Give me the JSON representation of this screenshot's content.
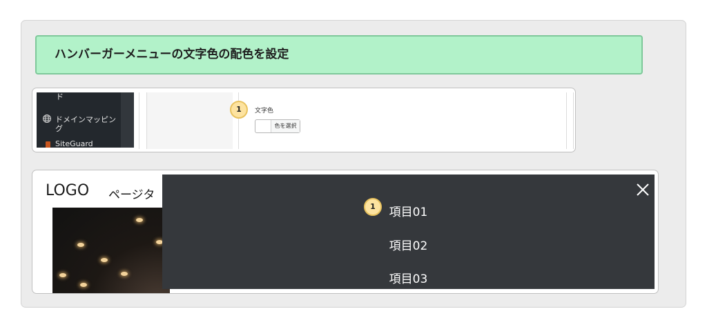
{
  "banner": {
    "title": "ハンバーガーメニューの文字色の配色を設定"
  },
  "settings": {
    "sidebar": {
      "top_fragment": "ド",
      "item1_line1": "ドメインマッピン",
      "item1_line2": "グ",
      "item2": "SiteGuard"
    },
    "badge": "1",
    "field_label": "文字色",
    "picker_button": "色を選択"
  },
  "preview": {
    "logo": "LOGO",
    "page_title": "ページタ",
    "badge": "1",
    "menu_items": [
      "項目01",
      "項目02",
      "項目03"
    ]
  },
  "colors": {
    "banner_bg": "#b2f2c9",
    "overlay_bg": "#35383c",
    "badge_bg": "#fde3a0"
  }
}
